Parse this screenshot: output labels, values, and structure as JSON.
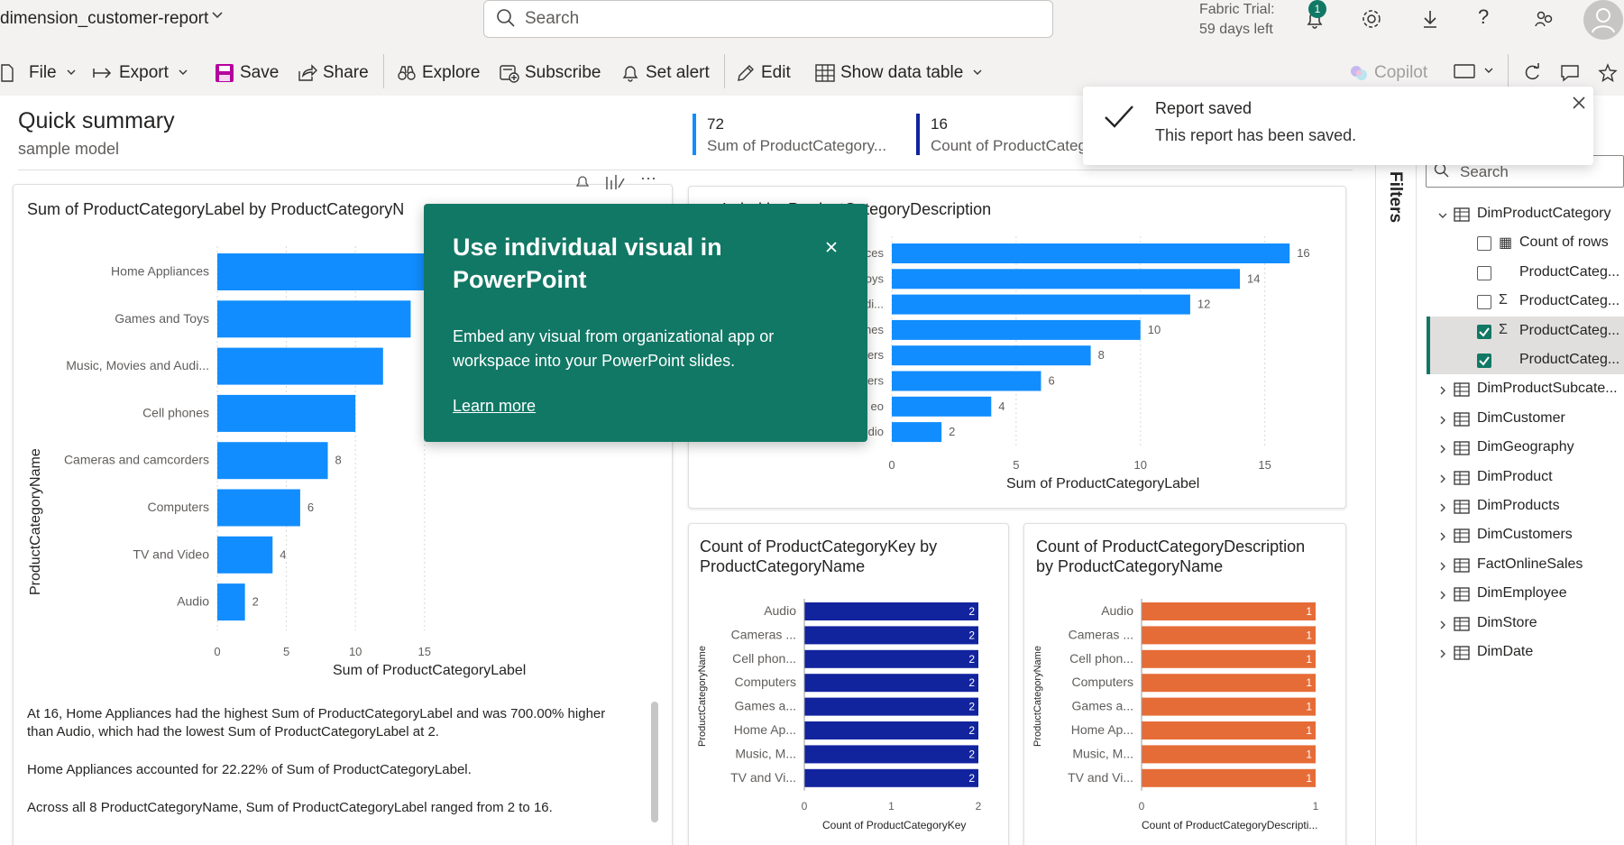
{
  "header": {
    "report_title": "dimension_customer-report",
    "search_placeholder": "Search",
    "trial_line1": "Fabric Trial:",
    "trial_line2": "59 days left",
    "notification_count": "1"
  },
  "toolbar": {
    "file": "File",
    "export": "Export",
    "save": "Save",
    "share": "Share",
    "explore": "Explore",
    "subscribe": "Subscribe",
    "set_alert": "Set alert",
    "edit": "Edit",
    "show_data_table": "Show data table",
    "copilot": "Copilot"
  },
  "summary": {
    "title": "Quick summary",
    "subtitle": "sample model",
    "kpi1_value": "72",
    "kpi1_label": "Sum of ProductCategory...",
    "kpi2_value": "16",
    "kpi2_label": "Count of ProductCateg"
  },
  "toast": {
    "title": "Report saved",
    "message": "This report has been saved."
  },
  "popup": {
    "title_line1": "Use individual visual in",
    "title_line2": "PowerPoint",
    "body_line1": "Embed any visual from organizational app or",
    "body_line2": "workspace into your PowerPoint slides.",
    "link": "Learn more"
  },
  "narrative": {
    "p1_line1": "At 16, Home Appliances had the highest Sum of ProductCategoryLabel and was 700.00% higher",
    "p1_line2": "than Audio, which had the lowest Sum of ProductCategoryLabel at 2.",
    "p2": "Home Appliances accounted for 22.22% of Sum of ProductCategoryLabel.",
    "p3": "Across all 8 ProductCategoryName, Sum of ProductCategoryLabel ranged from 2 to 16."
  },
  "filters_label": "Filters",
  "data_pane": {
    "search_placeholder": "Search",
    "tables": [
      {
        "name": "DimProductCategory",
        "expanded": true
      },
      {
        "name": "DimProductSubcate..."
      },
      {
        "name": "DimCustomer"
      },
      {
        "name": "DimGeography"
      },
      {
        "name": "DimProduct"
      },
      {
        "name": "DimProducts"
      },
      {
        "name": "DimCustomers"
      },
      {
        "name": "FactOnlineSales"
      },
      {
        "name": "DimEmployee"
      },
      {
        "name": "DimStore"
      },
      {
        "name": "DimDate"
      }
    ],
    "fields": [
      {
        "name": "Count of rows",
        "checked": false,
        "icon": "calculator-icon"
      },
      {
        "name": "ProductCateg...",
        "checked": false,
        "icon": ""
      },
      {
        "name": "ProductCateg...",
        "checked": false,
        "icon": "sigma-icon"
      },
      {
        "name": "ProductCateg...",
        "checked": true,
        "icon": "sigma-icon"
      },
      {
        "name": "ProductCateg...",
        "checked": true,
        "icon": ""
      }
    ]
  },
  "chart_data": [
    {
      "type": "bar",
      "title": "Sum of ProductCategoryLabel by ProductCategoryN",
      "xlabel": "Sum of ProductCategoryLabel",
      "ylabel": "ProductCategoryName",
      "categories": [
        "Home Appliances",
        "Games and Toys",
        "Music, Movies and Audi...",
        "Cell phones",
        "Cameras and camcorders",
        "Computers",
        "TV and Video",
        "Audio"
      ],
      "values": [
        16,
        14,
        12,
        10,
        8,
        6,
        4,
        2
      ],
      "data_labels": [
        "",
        "",
        "",
        "",
        "8",
        "6",
        "4",
        "2"
      ],
      "xticks": [
        "0",
        "5",
        "10",
        "15"
      ],
      "xlim": [
        0,
        18
      ],
      "color": "#118dff"
    },
    {
      "type": "bar",
      "title": "oryLabel by ProductCategoryDescription",
      "xlabel": "Sum of ProductCategoryLabel",
      "categories": [
        "ces",
        "oys",
        "di...",
        "nes",
        "ers",
        "ers",
        "eo",
        "dio"
      ],
      "values": [
        16,
        14,
        12,
        10,
        8,
        6,
        4,
        2
      ],
      "xticks": [
        "0",
        "5",
        "10",
        "15"
      ],
      "xlim": [
        0,
        16.5
      ],
      "color": "#118dff"
    },
    {
      "type": "bar",
      "title_line1": "Count of ProductCategoryKey by",
      "title_line2": "ProductCategoryName",
      "xlabel": "Count of ProductCategoryKey",
      "ylabel": "ProductCategoryName",
      "categories": [
        "Audio",
        "Cameras ...",
        "Cell phon...",
        "Computers",
        "Games a...",
        "Home Ap...",
        "Music, M...",
        "TV and Vi..."
      ],
      "values": [
        2,
        2,
        2,
        2,
        2,
        2,
        2,
        2
      ],
      "xticks": [
        "0",
        "1",
        "2"
      ],
      "xlim": [
        0,
        2
      ],
      "color": "#12239e"
    },
    {
      "type": "bar",
      "title_line1": "Count of ProductCategoryDescription",
      "title_line2": "by ProductCategoryName",
      "xlabel": "Count of ProductCategoryDescripti...",
      "ylabel": "ProductCategoryName",
      "categories": [
        "Audio",
        "Cameras ...",
        "Cell phon...",
        "Computers",
        "Games a...",
        "Home Ap...",
        "Music, M...",
        "TV and Vi..."
      ],
      "values": [
        1,
        1,
        1,
        1,
        1,
        1,
        1,
        1
      ],
      "xticks": [
        "0",
        "1"
      ],
      "xlim": [
        0,
        1
      ],
      "color": "#e66c37"
    }
  ]
}
